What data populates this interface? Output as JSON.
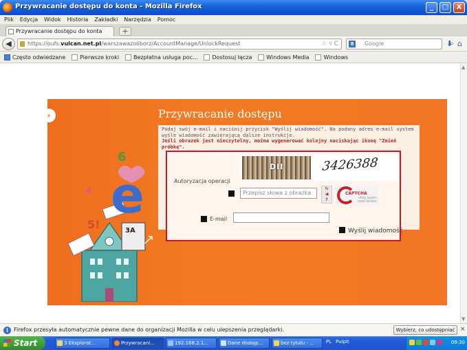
{
  "window": {
    "title": "Przywracanie dostępu do konta - Mozilla Firefox",
    "controls": {
      "minimize": "_",
      "maximize": "□",
      "close": "X"
    }
  },
  "menu": [
    "Plik",
    "Edycja",
    "Widok",
    "Historia",
    "Zakładki",
    "Narzędzia",
    "Pomoc"
  ],
  "tab": {
    "title": "Przywracanie dostępu do konta",
    "new_tab": "+"
  },
  "nav": {
    "url_prefix": "https://oufs.",
    "url_host": "vulcan.net.pl",
    "url_path": "/warszawazoliborz/AccountManage/UnlockRequest",
    "url_icons": "☆ ▿ C",
    "search_engine": "8",
    "search_placeholder": "Google",
    "back": "◀",
    "search": "⌕",
    "download": "⬇",
    "home": "⌂"
  },
  "bookmarks": [
    "Często odwiedzane",
    "Pierwsze kroki",
    "Bezpłatna usługa poc...",
    "Dostosuj łącza",
    "Windows Media",
    "Windows"
  ],
  "page": {
    "heading": "Przywracanie dostępu",
    "description": "Podaj swój e-mail i naciśnij przycisk \"Wyślij wiadomość\". Na podany adres e-mail system wyśle wiadomość zawierającą dalsze instrukcje.",
    "warning": "Jeśli obrazek jest nieczytelny, można wygenerować kolejny naciskając ikonę \"Zmień próbkę\".",
    "auth_label": "Autoryzacja operacji",
    "captcha_text_1": "DII",
    "captcha_text_2": "3426388",
    "captcha_placeholder": "Przepisz słowa z obrazka",
    "email_label": "E-mail",
    "email_value": "",
    "send_label": "Wyślij wiadomość",
    "recaptcha": {
      "brand": "CAPTCHA",
      "tagline": "stop spam. read books."
    },
    "illustration": {
      "letter": "e",
      "num1": "6",
      "num2": "4",
      "num3": "5!",
      "tag": "3A"
    },
    "chevron": "›"
  },
  "notification": {
    "message": "Firefox przesyła automatycznie pewne dane do organizacji Mozilla w celu ulepszenia przeglądarki.",
    "button": "Wybierz, co udostępniać",
    "close": "×",
    "info": "i"
  },
  "taskbar": {
    "start": "Start",
    "items": [
      "3 Eksplorat...",
      "Przywracani...",
      "192.168.2.1...",
      "Dane dostęp...",
      "bez tytułu - ..."
    ],
    "lang": "PL",
    "desktop": "Pulpit",
    "clock": "09:30"
  },
  "colors": {
    "accent_orange": "#ef6e1e",
    "warning_red": "#b5261e",
    "highlight_border": "#d4141b"
  }
}
